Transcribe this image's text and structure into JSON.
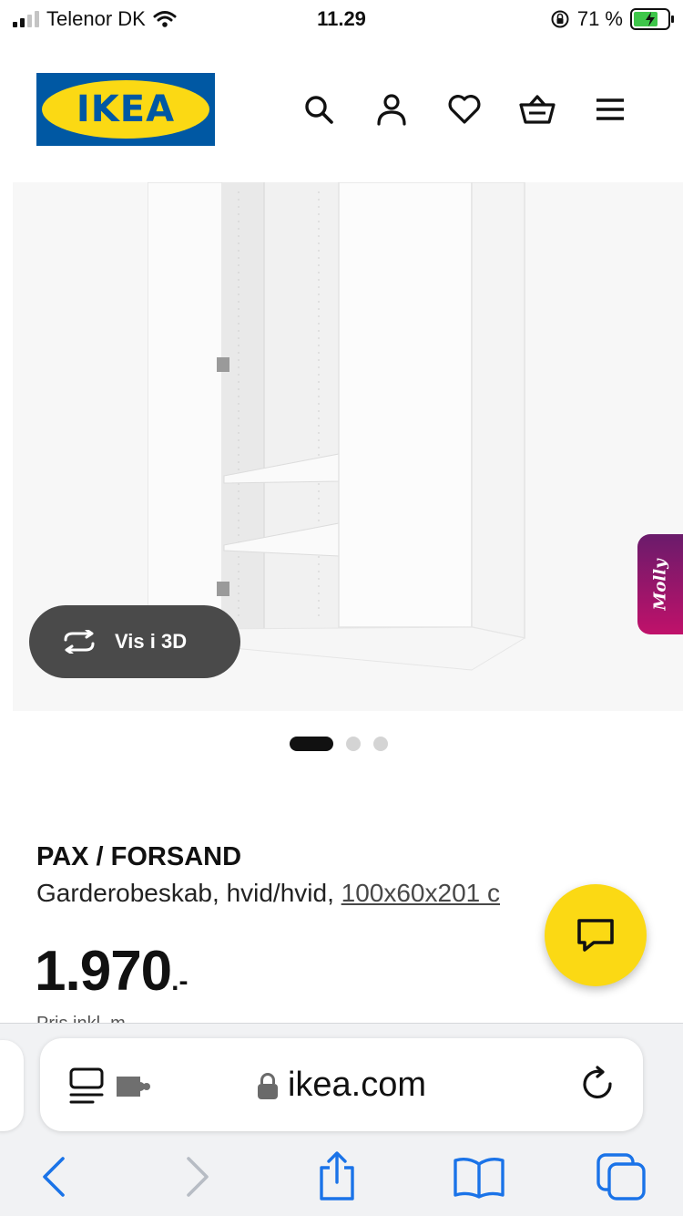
{
  "status_bar": {
    "carrier": "Telenor DK",
    "time": "11.29",
    "battery": "71 %",
    "battery_level": 0.71,
    "icons": [
      "signal-icon",
      "wifi-icon",
      "orientation-lock-icon",
      "battery-charging-icon"
    ]
  },
  "header": {
    "logo_text": "IKEA",
    "icons": [
      "search-icon",
      "user-icon",
      "heart-icon",
      "basket-icon",
      "menu-icon"
    ]
  },
  "gallery": {
    "view_3d_label": "Vis i 3D",
    "assistant_label": "Molly",
    "slide_count": 3,
    "active_slide": 1
  },
  "product": {
    "name": "PAX / FORSAND",
    "description": "Garderobeskab, hvid/hvid, ",
    "size": "100x60x201 c",
    "price": "1.970",
    "price_suffix": ".-",
    "price_note": "Pris inkl. m"
  },
  "browser": {
    "url": "ikea.com",
    "toolbar": [
      "back-icon",
      "forward-icon",
      "share-icon",
      "bookmarks-icon",
      "tabs-icon"
    ]
  },
  "colors": {
    "ikea_blue": "#0058a3",
    "ikea_yellow": "#fbd914",
    "safari_blue": "#1a73e8"
  }
}
